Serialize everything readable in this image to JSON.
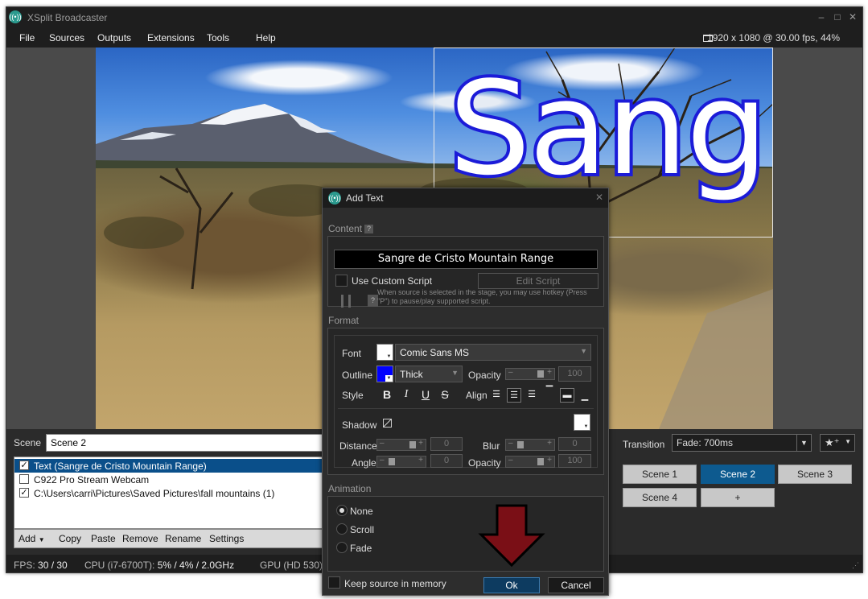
{
  "window": {
    "title": "XSplit Broadcaster",
    "minimize": "–",
    "maximize": "□",
    "close": "✕"
  },
  "menu": [
    "File",
    "Sources",
    "Outputs",
    "Extensions",
    "Tools",
    "Help"
  ],
  "resolution_info": "1920 x 1080 @ 30.00 fps, 44%",
  "stage": {
    "overlay_text": "Sangr"
  },
  "scene": {
    "label": "Scene",
    "name": "Scene 2"
  },
  "sources": [
    {
      "label": "Text (Sangre de Cristo Mountain Range)",
      "checked": true,
      "selected": true
    },
    {
      "label": "C922 Pro Stream Webcam",
      "checked": false,
      "selected": false
    },
    {
      "label": "C:\\Users\\carri\\Pictures\\Saved Pictures\\fall mountains (1)",
      "checked": true,
      "selected": false
    }
  ],
  "source_toolbar": [
    "Add",
    "Copy",
    "Paste",
    "Remove",
    "Rename",
    "Settings"
  ],
  "transition": {
    "label": "Transition",
    "value": "Fade: 700ms"
  },
  "scene_buttons": [
    {
      "label": "Scene 1",
      "active": false
    },
    {
      "label": "Scene 2",
      "active": true
    },
    {
      "label": "Scene 3",
      "active": false
    },
    {
      "label": "Scene 4",
      "active": false
    },
    {
      "label": "+",
      "active": false
    }
  ],
  "status": {
    "fps_label": "FPS:",
    "fps_value": "30 / 30",
    "cpu_label": "CPU (i7-6700T):",
    "cpu_value": "5% / 4% / 2.0GHz",
    "gpu_label": "GPU (HD 530):"
  },
  "dialog": {
    "title": "Add Text",
    "content_title": "Content",
    "text_value": "Sangre de Cristo Mountain Range",
    "use_custom_script": "Use Custom Script",
    "edit_script": "Edit Script",
    "hint": "When source is selected in the stage, you may use hotkey (Press \"P\") to pause/play supported script.",
    "format_title": "Format",
    "font_label": "Font",
    "font_value": "Comic Sans MS",
    "outline_label": "Outline",
    "outline_value": "Thick",
    "outline_color": "#0000ff",
    "opacity_label": "Opacity",
    "opacity_value": "100",
    "style_label": "Style",
    "style_buttons": [
      "B",
      "I",
      "U",
      "S"
    ],
    "align_label": "Align",
    "shadow_label": "Shadow",
    "distance_label": "Distance",
    "distance_value": "0",
    "blur_label": "Blur",
    "blur_value": "0",
    "angle_label": "Angle",
    "angle_value": "0",
    "shadow_opacity_label": "Opacity",
    "shadow_opacity_value": "100",
    "animation_title": "Animation",
    "animation_options": [
      "None",
      "Scroll",
      "Fade"
    ],
    "animation_selected": "None",
    "keep_in_memory": "Keep source in memory",
    "ok": "Ok",
    "cancel": "Cancel"
  }
}
